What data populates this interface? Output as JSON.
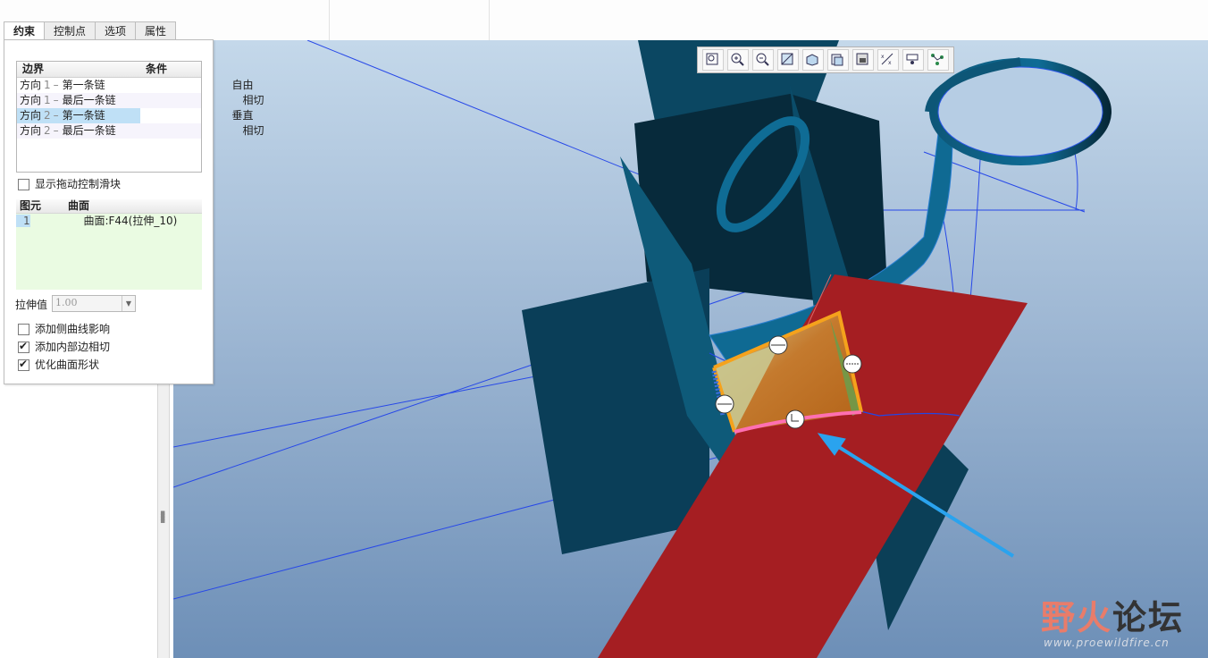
{
  "tabs": [
    {
      "label": "约束",
      "active": true
    },
    {
      "label": "控制点",
      "active": false
    },
    {
      "label": "选项",
      "active": false
    },
    {
      "label": "属性",
      "active": false
    }
  ],
  "boundary_table": {
    "headers": {
      "boundary": "边界",
      "condition": "条件"
    },
    "rows": [
      {
        "dir": "方向",
        "num": "1",
        "sep": "–",
        "chain": "第一条链",
        "condition": "自由",
        "selected": false
      },
      {
        "dir": "方向",
        "num": "1",
        "sep": "–",
        "chain": "最后一条链",
        "condition": "相切",
        "selected": false
      },
      {
        "dir": "方向",
        "num": "2",
        "sep": "–",
        "chain": "第一条链",
        "condition": "垂直",
        "selected": true
      },
      {
        "dir": "方向",
        "num": "2",
        "sep": "–",
        "chain": "最后一条链",
        "condition": "相切",
        "selected": false
      }
    ]
  },
  "show_drag_handles": {
    "label": "显示拖动控制滑块",
    "checked": false
  },
  "reference_table": {
    "headers": {
      "element": "图元",
      "surface": "曲面"
    },
    "rows": [
      {
        "element": "1",
        "surface": "曲面:F44(拉伸_10)"
      }
    ]
  },
  "stretch": {
    "label": "拉伸值",
    "value": "1.00"
  },
  "options": [
    {
      "label": "添加侧曲线影响",
      "checked": false
    },
    {
      "label": "添加内部边相切",
      "checked": true
    },
    {
      "label": "优化曲面形状",
      "checked": true
    }
  ],
  "toolbar_icons": [
    "refit-icon",
    "zoom-in-icon",
    "zoom-out-icon",
    "repaint-icon",
    "display-style-icon",
    "saved-views-icon",
    "view-manager-icon",
    "datum-display-icon",
    "spin-center-icon",
    "annotation-display-icon"
  ],
  "watermark": {
    "name_part1": "野火",
    "name_part2": "论坛",
    "url": "www.proewildfire.cn"
  },
  "colors": {
    "viewport_top": "#c4d8ea",
    "viewport_bottom": "#6d8fb7",
    "model_dark": "#0b3f57",
    "model_mid": "#0e5a79",
    "red_surface": "#a51e22",
    "selection_orange": "#f5a21c",
    "arrow_blue": "#2aa3ee",
    "highlight_pink": "#ff6fb2"
  }
}
